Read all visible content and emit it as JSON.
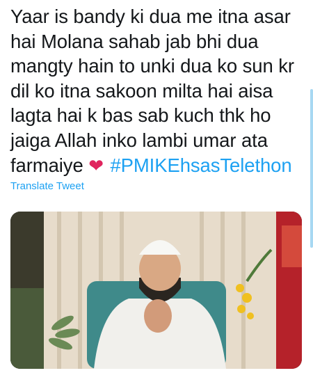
{
  "tweet": {
    "text_main": "Yaar is bandy ki dua me itna asar hai Molana sahab jab bhi dua mangty hain to unki dua ko sun kr dil ko itna sakoon milta hai aisa lagta hai k bas sab kuch thk ho jaiga Allah inko lambi umar ata farmaiye",
    "emoji": "❤",
    "hashtag": "#PMIKEhsasTelethon",
    "translate_label": "Translate Tweet"
  },
  "media": {
    "icon": "video-thumbnail-icon"
  },
  "colors": {
    "text": "#14171a",
    "link": "#1da1f2",
    "heart": "#e0245e"
  }
}
